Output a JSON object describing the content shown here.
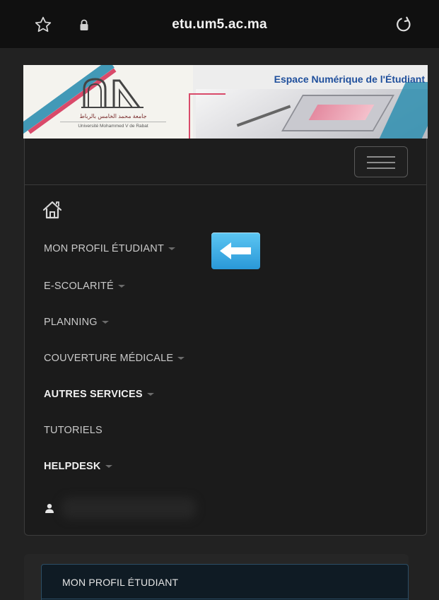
{
  "browser": {
    "url": "etu.um5.ac.ma",
    "icons": [
      "star-icon",
      "lock-icon",
      "reload-icon"
    ]
  },
  "banner": {
    "title": "Espace Numérique de l'Étudiant",
    "university_ar": "جامعة محمد الخامس بالرباط",
    "university_fr": "Université Mohammed V de Rabat"
  },
  "nav": {
    "menu_icon": "hamburger-icon",
    "home_icon": "home-icon",
    "items": [
      {
        "label": "MON PROFIL ÉTUDIANT",
        "dropdown": true,
        "bold": false
      },
      {
        "label": "E-SCOLARITÉ",
        "dropdown": true,
        "bold": false
      },
      {
        "label": "PLANNING",
        "dropdown": true,
        "bold": false
      },
      {
        "label": "COUVERTURE MÉDICALE",
        "dropdown": true,
        "bold": false
      },
      {
        "label": "AUTRES SERVICES",
        "dropdown": true,
        "bold": true
      },
      {
        "label": "TUTORIELS",
        "dropdown": false,
        "bold": false
      },
      {
        "label": "HELPDESK",
        "dropdown": true,
        "bold": true
      }
    ],
    "user_icon": "user-icon"
  },
  "annotation": {
    "icon": "left-arrow-icon"
  },
  "card": {
    "button_label": "MON PROFIL ÉTUDIANT"
  },
  "colors": {
    "background": "#222222",
    "panel": "#1b1b1b",
    "accent_blue": "#2a98d8",
    "banner_title": "#1f4f9c"
  }
}
